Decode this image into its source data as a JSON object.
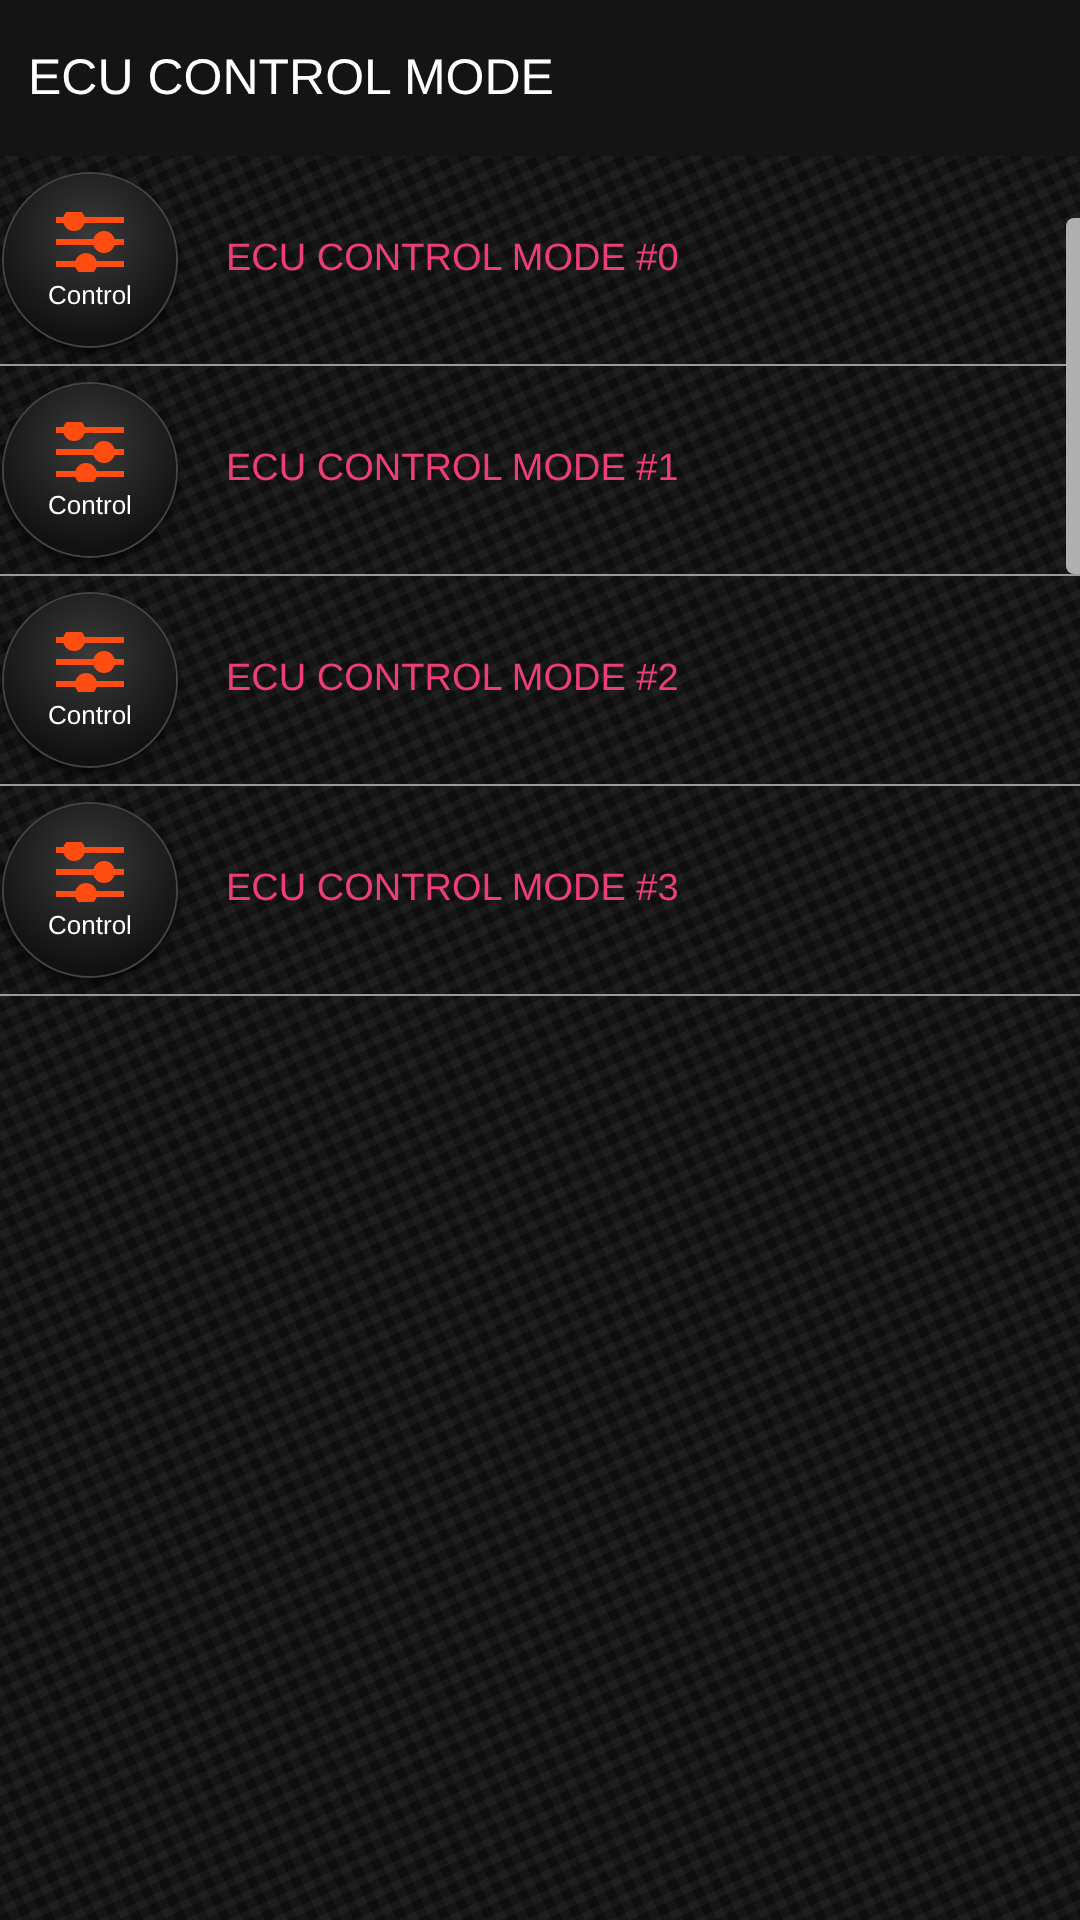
{
  "app_bar": {
    "title": "ECU CONTROL MODE"
  },
  "items": [
    {
      "badge": "Control",
      "label": "ECU CONTROL MODE #0"
    },
    {
      "badge": "Control",
      "label": "ECU CONTROL MODE #1"
    },
    {
      "badge": "Control",
      "label": "ECU CONTROL MODE #2"
    },
    {
      "badge": "Control",
      "label": "ECU CONTROL MODE #3"
    }
  ]
}
